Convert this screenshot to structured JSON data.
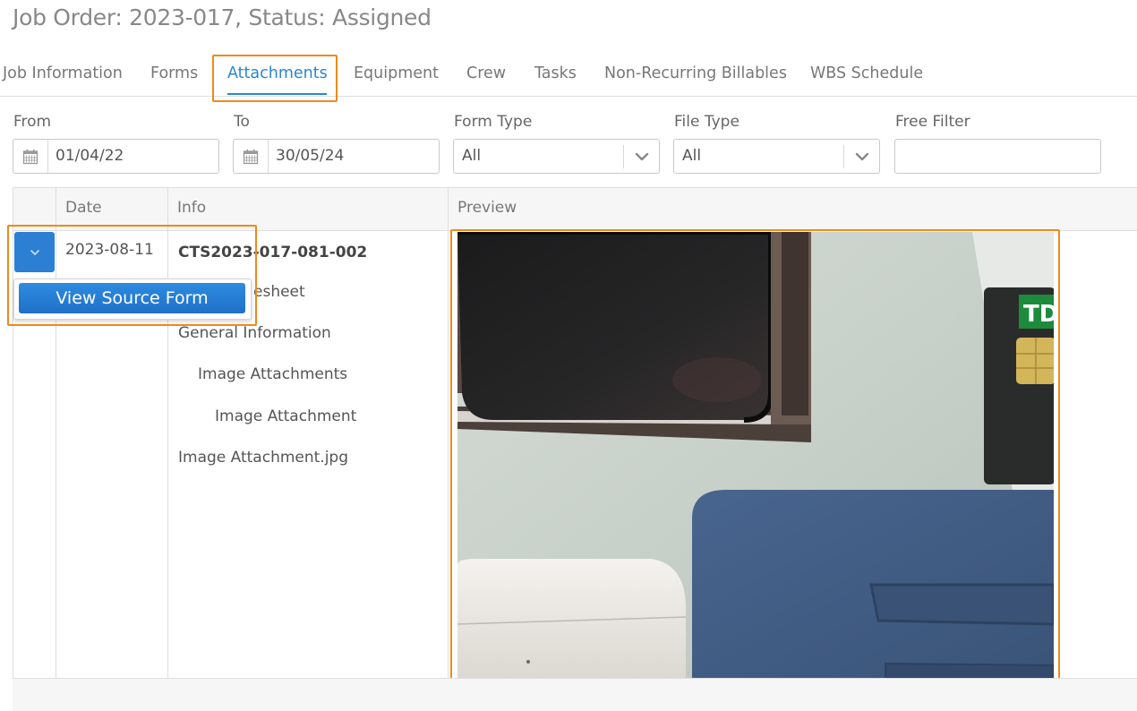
{
  "page": {
    "title": "Job Order: 2023-017, Status: Assigned"
  },
  "tabs": [
    {
      "label": "Job Information"
    },
    {
      "label": "Forms"
    },
    {
      "label": "Attachments",
      "active": true
    },
    {
      "label": "Equipment"
    },
    {
      "label": "Crew"
    },
    {
      "label": "Tasks"
    },
    {
      "label": "Non-Recurring Billables"
    },
    {
      "label": "WBS Schedule"
    }
  ],
  "filters": {
    "from": {
      "label": "From",
      "value": "01/04/22"
    },
    "to": {
      "label": "To",
      "value": "30/05/24"
    },
    "form_type": {
      "label": "Form Type",
      "value": "All"
    },
    "file_type": {
      "label": "File Type",
      "value": "All"
    },
    "free_filter": {
      "label": "Free Filter",
      "value": ""
    }
  },
  "grid": {
    "columns": {
      "date": "Date",
      "info": "Info",
      "preview": "Preview"
    },
    "row": {
      "date": "2023-08-11",
      "info_title": "CTS2023-017-081-002",
      "info_form_suffix": "esheet",
      "info_lines": [
        "General Information",
        "Image Attachments",
        "Image Attachment",
        "Image Attachment.jpg"
      ]
    },
    "row_menu": {
      "view_source": "View Source Form"
    }
  },
  "colors": {
    "accent": "#2a86d1",
    "highlight": "#ef8a1b",
    "button": "#2c7fd3"
  }
}
